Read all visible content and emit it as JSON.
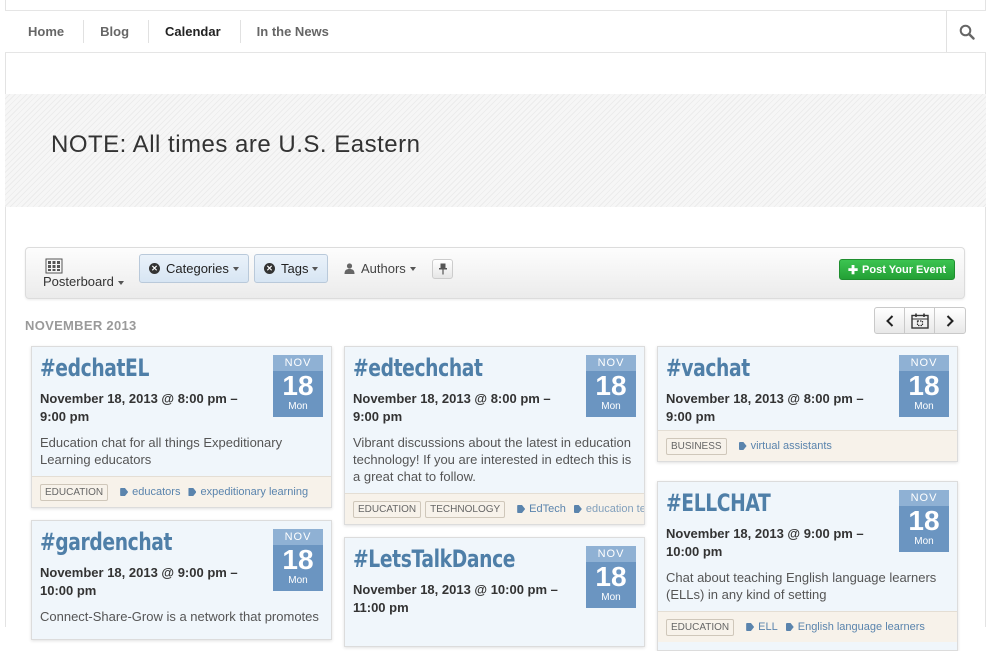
{
  "nav": {
    "items": [
      "Home",
      "Blog",
      "Calendar",
      "In the News"
    ],
    "active": "Calendar"
  },
  "banner": {
    "note": "NOTE: All times are U.S. Eastern"
  },
  "toolbar": {
    "posterboard": "Posterboard",
    "categories": "Categories",
    "tags": "Tags",
    "authors": "Authors",
    "post_event": "Post Your Event"
  },
  "month_label": "NOVEMBER 2013",
  "colors": {
    "accent": "#4f7fa8",
    "badge": "#6b95c1",
    "post_button": "#2eb243"
  },
  "events": [
    {
      "title": "#edchatEL",
      "when": "November 18, 2013 @ 8:00 pm – 9:00 pm",
      "desc": "Education chat for all things Expeditionary Learning educators",
      "month": "NOV",
      "day": "18",
      "weekday": "Mon",
      "categories": [
        "EDUCATION"
      ],
      "tags": [
        "educators",
        "expeditionary learning"
      ]
    },
    {
      "title": "#edtechchat",
      "when": "November 18, 2013 @ 8:00 pm – 9:00 pm",
      "desc": "Vibrant discussions about the latest in education technology! If you are interested in edtech this is a great chat to follow.",
      "month": "NOV",
      "day": "18",
      "weekday": "Mon",
      "categories": [
        "EDUCATION",
        "TECHNOLOGY"
      ],
      "tags": [
        "EdTech",
        "education te"
      ]
    },
    {
      "title": "#vachat",
      "when": "November 18, 2013 @ 8:00 pm – 9:00 pm",
      "desc": "",
      "month": "NOV",
      "day": "18",
      "weekday": "Mon",
      "categories": [
        "BUSINESS"
      ],
      "tags": [
        "virtual assistants"
      ]
    },
    {
      "title": "#gardenchat",
      "when": "November 18, 2013 @ 9:00 pm – 10:00 pm",
      "desc": "Connect-Share-Grow is a network that promotes",
      "month": "NOV",
      "day": "18",
      "weekday": "Mon",
      "categories": [],
      "tags": []
    },
    {
      "title": "#LetsTalkDance",
      "when": "November 18, 2013 @ 10:00 pm – 11:00 pm",
      "desc": "",
      "month": "NOV",
      "day": "18",
      "weekday": "Mon",
      "categories": [],
      "tags": []
    },
    {
      "title": "#ELLCHAT",
      "when": "November 18, 2013 @ 9:00 pm – 10:00 pm",
      "desc": "Chat about teaching English language learners (ELLs) in any kind of setting",
      "month": "NOV",
      "day": "18",
      "weekday": "Mon",
      "categories": [
        "EDUCATION"
      ],
      "tags": [
        "ELL",
        "English language learners"
      ]
    }
  ]
}
